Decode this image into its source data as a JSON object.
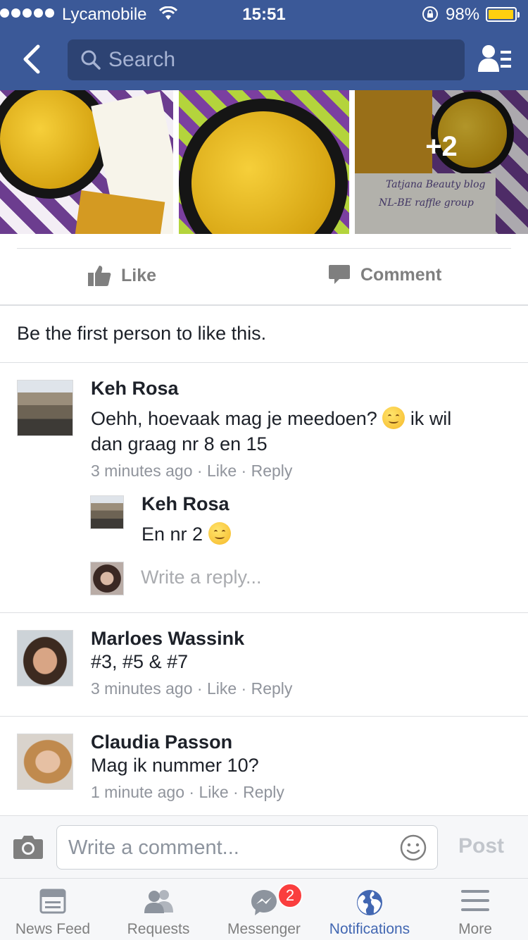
{
  "status_bar": {
    "carrier": "Lycamobile",
    "time": "15:51",
    "battery": "98%",
    "battery_level": 0.98
  },
  "nav": {
    "search_placeholder": "Search"
  },
  "photos": {
    "more_count": "+2",
    "captions": [
      "Tatjana Beauty blog",
      "NL-BE raffle group"
    ]
  },
  "actions": {
    "like_label": "Like",
    "comment_label": "Comment"
  },
  "likes_summary": "Be the first person to like this.",
  "comments": [
    {
      "author": "Keh Rosa",
      "text_before_emoji": "Oehh, hoevaak mag je meedoen?",
      "text_after_emoji_line1": "ik wil",
      "text_line2": "dan graag nr 8 en 15",
      "time": "3 minutes ago",
      "like": "Like",
      "reply": "Reply",
      "replies": [
        {
          "author": "Keh Rosa",
          "text": "En nr 2"
        }
      ],
      "reply_placeholder": "Write a reply..."
    },
    {
      "author": "Marloes Wassink",
      "text": "#3, #5 & #7",
      "time": "3 minutes ago",
      "like": "Like",
      "reply": "Reply"
    },
    {
      "author": "Claudia Passon",
      "text": "Mag ik nummer 10?",
      "time": "1 minute ago",
      "like": "Like",
      "reply": "Reply"
    }
  ],
  "composer": {
    "placeholder": "Write a comment...",
    "post_label": "Post"
  },
  "tabs": [
    {
      "label": "News Feed",
      "icon": "news-feed-icon"
    },
    {
      "label": "Requests",
      "icon": "friend-requests-icon"
    },
    {
      "label": "Messenger",
      "icon": "messenger-icon",
      "badge": "2"
    },
    {
      "label": "Notifications",
      "icon": "globe-icon",
      "active": true
    },
    {
      "label": "More",
      "icon": "menu-icon"
    }
  ],
  "colors": {
    "brand": "#3b5998",
    "active_tab": "#4267b2",
    "badge": "#fa3e3e",
    "battery": "#ffd00f"
  }
}
